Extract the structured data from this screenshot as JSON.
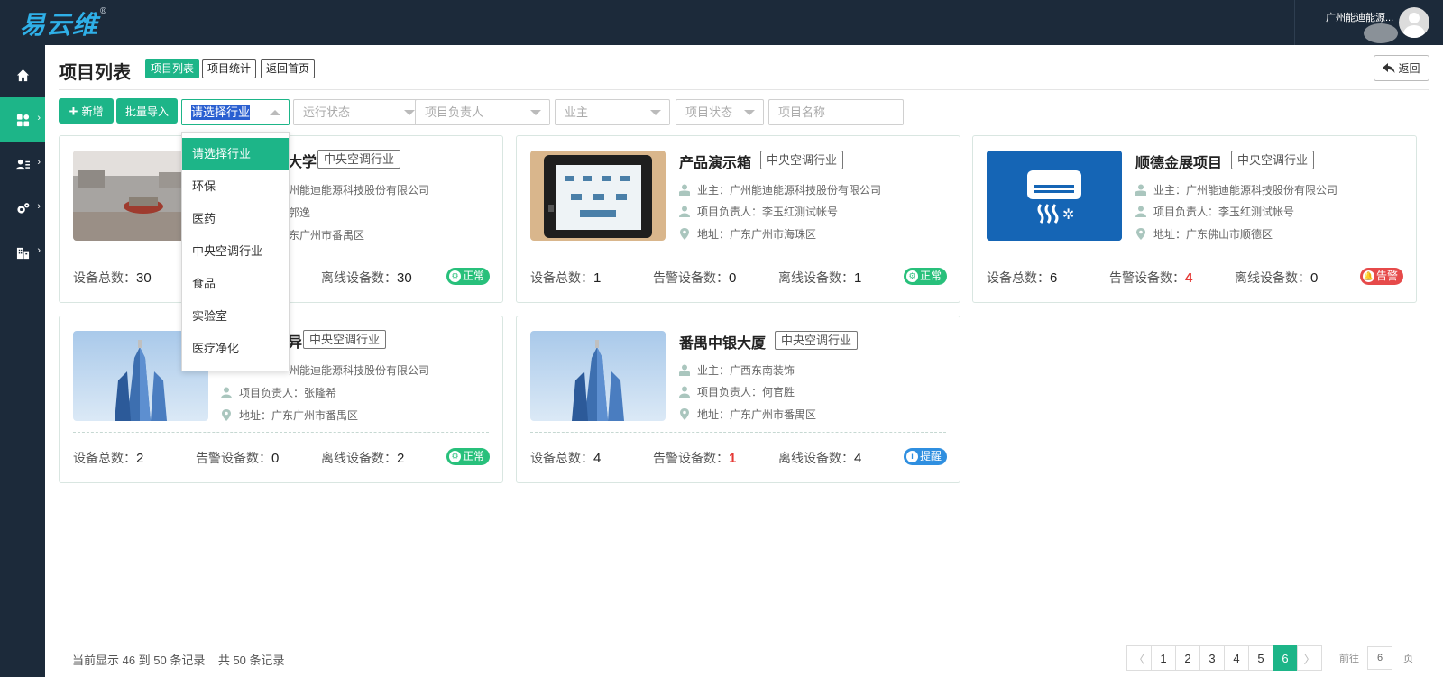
{
  "app": {
    "logo_text": "易云维",
    "logo_mark": "®",
    "user_name": "广州能迪能源..."
  },
  "sidebar": {
    "items": [
      {
        "icon": "home-icon"
      },
      {
        "icon": "dashboard-icon"
      },
      {
        "icon": "user-list-icon"
      },
      {
        "icon": "settings-icon"
      },
      {
        "icon": "building-icon"
      }
    ]
  },
  "header": {
    "title": "项目列表",
    "tabs": [
      {
        "label": "项目列表",
        "active": true
      },
      {
        "label": "项目统计"
      },
      {
        "label": "返回首页"
      }
    ],
    "back_label": "返回"
  },
  "filters": {
    "add_label": "新增",
    "import_label": "批量导入",
    "industry_value": "请选择行业",
    "run_status_placeholder": "运行状态",
    "manager_placeholder": "项目负责人",
    "owner_placeholder": "业主",
    "project_status_placeholder": "项目状态",
    "name_placeholder": "项目名称"
  },
  "industry_dropdown": {
    "options": [
      "请选择行业",
      "环保",
      "医药",
      "中央空调行业",
      "食品",
      "实验室",
      "医疗净化"
    ],
    "selected": "请选择行业"
  },
  "labels": {
    "owner_prefix": "业主：",
    "manager_prefix": "项目负责人：",
    "address_prefix": "地址：",
    "total_devices": "设备总数：",
    "alarm_devices": "告警设备数：",
    "offline_devices": "离线设备数："
  },
  "projects": [
    {
      "name": "大学",
      "industry": "中央空调行业",
      "owner": "州能迪能源科技股份有限公司",
      "manager": "郭逸",
      "address": "东广州市番禺区",
      "total": "30",
      "alarm": "",
      "offline": "30",
      "status": "正常",
      "status_color": "#28c07b"
    },
    {
      "name": "产品演示箱",
      "industry": "中央空调行业",
      "owner": "广州能迪能源科技股份有限公司",
      "manager": "李玉红测试帐号",
      "address": "广东广州市海珠区",
      "total": "1",
      "alarm": "0",
      "offline": "1",
      "status": "正常",
      "status_color": "#28c07b"
    },
    {
      "name": "顺德金展项目",
      "industry": "中央空调行业",
      "owner": "广州能迪能源科技股份有限公司",
      "manager": "李玉红测试帐号",
      "address": "广东佛山市顺德区",
      "total": "6",
      "alarm": "4",
      "offline": "0",
      "status": "告警",
      "status_color": "#e64a4a"
    },
    {
      "name": "异",
      "industry": "中央空调行业",
      "owner": "州能迪能源科技股份有限公司",
      "manager": "张隆希",
      "address": "广东广州市番禺区",
      "total": "2",
      "alarm": "0",
      "offline": "2",
      "status": "正常",
      "status_color": "#28c07b"
    },
    {
      "name": "番禺中银大厦",
      "industry": "中央空调行业",
      "owner": "广西东南装饰",
      "manager": "何官胜",
      "address": "广东广州市番禺区",
      "total": "4",
      "alarm": "1",
      "offline": "4",
      "status": "提醒",
      "status_color": "#2f8fe0"
    }
  ],
  "footer": {
    "record_range": "当前显示 46 到 50 条记录",
    "record_total": "共 50 条记录",
    "pages": [
      "1",
      "2",
      "3",
      "4",
      "5",
      "6"
    ],
    "current_page": "6",
    "prev": "〈",
    "next": "〉",
    "goto_label": "前往",
    "goto_value": "6",
    "goto_suffix": "页"
  },
  "colors": {
    "primary": "#1db588",
    "sidebar_bg": "#1c2a3a",
    "alarm_red": "#e53935",
    "info_blue": "#2f8fe0"
  }
}
